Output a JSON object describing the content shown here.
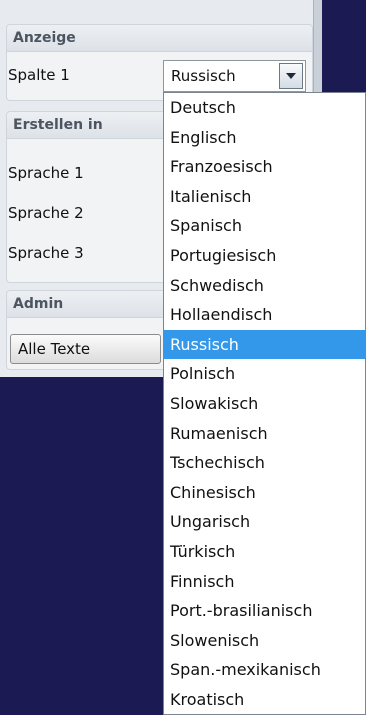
{
  "anzeige": {
    "title": "Anzeige",
    "spalte_label": "Spalte 1",
    "selected": "Russisch"
  },
  "erstellen": {
    "title": "Erstellen in",
    "rows": [
      "Sprache 1",
      "Sprache 2",
      "Sprache 3"
    ]
  },
  "admin": {
    "title": "Admin",
    "button_label": "Alle Texte"
  },
  "dropdown": {
    "options": [
      "Deutsch",
      "Englisch",
      "Franzoesisch",
      "Italienisch",
      "Spanisch",
      "Portugiesisch",
      "Schwedisch",
      "Hollaendisch",
      "Russisch",
      "Polnisch",
      "Slowakisch",
      "Rumaenisch",
      "Tschechisch",
      "Chinesisch",
      "Ungarisch",
      "Türkisch",
      "Finnisch",
      "Port.-brasilianisch",
      "Slowenisch",
      "Span.-mexikanisch",
      "Kroatisch"
    ],
    "selected_index": 8
  },
  "colors": {
    "highlight": "#3398ea",
    "background": "#1b1a52"
  }
}
